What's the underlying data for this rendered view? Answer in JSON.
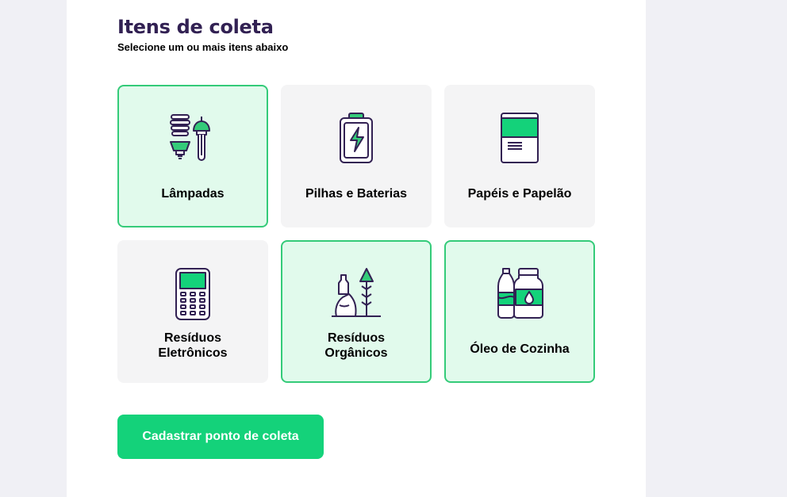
{
  "header": {
    "title": "Itens de coleta",
    "subtitle": "Selecione um ou mais itens abaixo"
  },
  "items": [
    {
      "label": "Lâmpadas",
      "icon": "lamps-icon",
      "selected": true
    },
    {
      "label": "Pilhas e Baterias",
      "icon": "battery-icon",
      "selected": false
    },
    {
      "label": "Papéis e Papelão",
      "icon": "paper-icon",
      "selected": false
    },
    {
      "label_line1": "Resíduos",
      "label_line2": "Eletrônicos",
      "icon": "electronics-icon",
      "selected": false
    },
    {
      "label_line1": "Resíduos",
      "label_line2": "Orgânicos",
      "icon": "organic-icon",
      "selected": true
    },
    {
      "label": "Óleo de Cozinha",
      "icon": "oil-icon",
      "selected": true
    }
  ],
  "actions": {
    "submit_label": "Cadastrar ponto de coleta"
  },
  "colors": {
    "accent": "#34cb79",
    "button": "#14d27a",
    "selected_bg": "#e1faec",
    "title": "#322153",
    "icon_stroke": "#322153"
  }
}
